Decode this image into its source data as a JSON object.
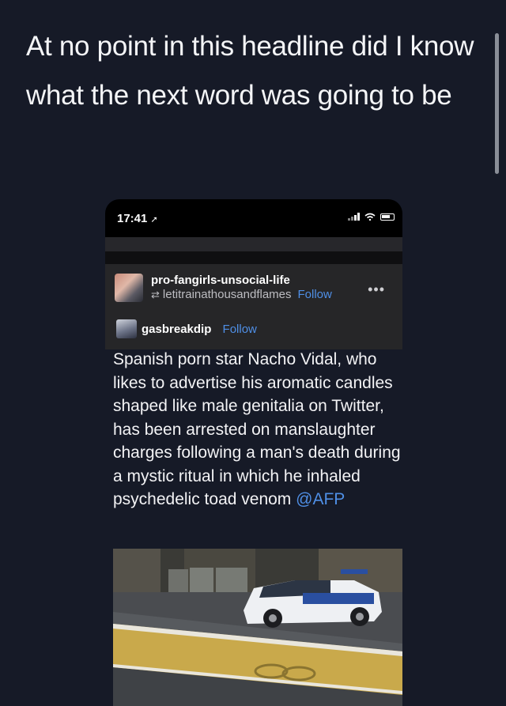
{
  "caption": "At no point in this headline did I know what the next word was going to be",
  "phone": {
    "status_time": "17:41",
    "location_icon": "location-arrow-icon",
    "signal_icon": "signal-icon",
    "wifi_icon": "wifi-icon",
    "battery_icon": "battery-icon"
  },
  "post": {
    "user": "pro-fangirls-unsocial-life",
    "reblog_icon": "reblog-icon",
    "reblogged_from": "letitrainathousandflames",
    "follow_label": "Follow",
    "more_label": "•••",
    "source_user": "gasbreakdip",
    "source_follow_label": "Follow",
    "text": "Spanish porn star Nacho Vidal, who likes to advertise his aromatic candles shaped like male genitalia on Twitter, has been arrested on manslaughter charges following a man's death during a mystic ritual in which he inhaled psychedelic toad venom ",
    "mention": "@AFP"
  },
  "colors": {
    "background": "#161a27",
    "link": "#4f8fe6",
    "post_background": "#262628"
  }
}
